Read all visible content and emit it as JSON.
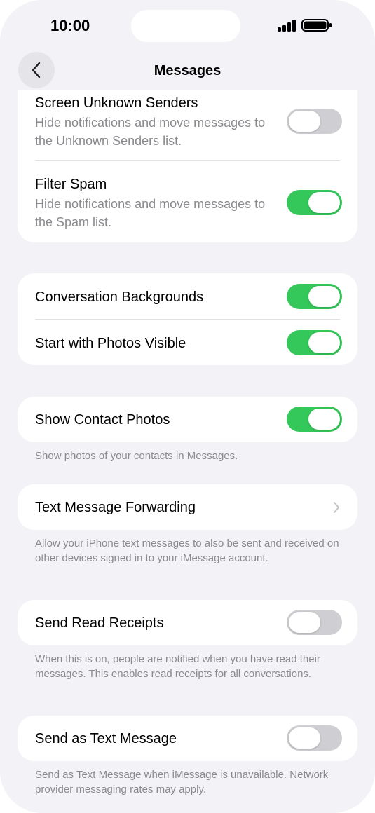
{
  "status_bar": {
    "time": "10:00"
  },
  "nav": {
    "title": "Messages"
  },
  "colors": {
    "accent_green": "#34c759",
    "toggle_off": "#cfcfd3",
    "secondary_text": "#8a8a8e",
    "background": "#f2f2f7"
  },
  "icons": {
    "back": "chevron-left-icon",
    "disclosure": "chevron-right-icon",
    "signal": "signal-icon",
    "battery": "battery-icon"
  },
  "filtering": {
    "screen_unknown": {
      "title": "Screen Unknown Senders",
      "subtitle": "Hide notifications and move messages to the Unknown Senders list.",
      "on": false
    },
    "filter_spam": {
      "title": "Filter Spam",
      "subtitle": "Hide notifications and move messages to the Spam list.",
      "on": true
    }
  },
  "backgrounds": {
    "conversation_backgrounds": {
      "title": "Conversation Backgrounds",
      "on": true
    },
    "start_with_photos": {
      "title": "Start with Photos Visible",
      "on": true
    }
  },
  "contact_photos": {
    "title": "Show Contact Photos",
    "on": true,
    "footer": "Show photos of your contacts in Messages."
  },
  "forwarding": {
    "title": "Text Message Forwarding",
    "footer": "Allow your iPhone text messages to also be sent and received on other devices signed in to your iMessage account."
  },
  "read_receipts": {
    "title": "Send Read Receipts",
    "on": false,
    "footer": "When this is on, people are notified when you have read their messages. This enables read receipts for all conversations."
  },
  "send_as_text": {
    "title": "Send as Text Message",
    "on": false,
    "footer": "Send as Text Message when iMessage is unavailable. Network provider messaging rates may apply."
  }
}
